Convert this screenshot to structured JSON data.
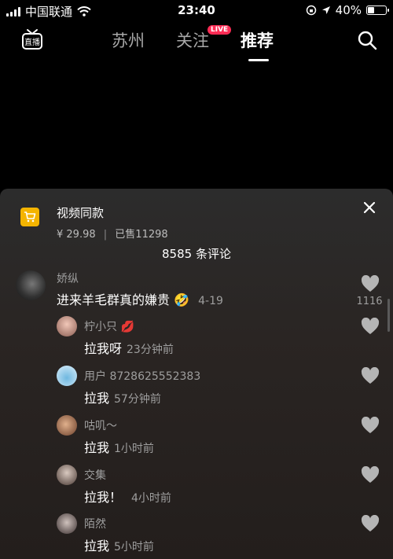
{
  "status_bar": {
    "carrier": "中国联通",
    "time": "23:40",
    "battery": "40%",
    "battery_level": 0.4,
    "icons": [
      "signal-icon",
      "wifi-icon",
      "rotation-lock-icon",
      "location-icon",
      "battery-icon"
    ]
  },
  "nav": {
    "tabs": [
      {
        "label": "苏州"
      },
      {
        "label": "关注"
      },
      {
        "label": "推荐"
      }
    ],
    "active_tab": "推荐",
    "live_badge": "LIVE",
    "live_icon_label": "直播",
    "accent_color": "#fe2c55"
  },
  "product": {
    "title": "视频同款",
    "price": "¥ 29.98",
    "separator": "|",
    "sold": "已售11298"
  },
  "comments_count": "8585 条评论",
  "comments": [
    {
      "name": "娇纵",
      "text": "进来羊毛群真的嫌贵",
      "emoji": "🤣",
      "time": "4-19",
      "likes": "1116"
    },
    {
      "name": "柠小只",
      "badge": "💋",
      "text": "拉我呀",
      "time": "23分钟前"
    },
    {
      "name": "用户 8728625552383",
      "text": "拉我",
      "time": "57分钟前"
    },
    {
      "name": "咕叽～",
      "text": "拉我",
      "time": "1小时前"
    },
    {
      "name": "交集",
      "text": "拉我！",
      "time": "4小时前"
    },
    {
      "name": "陌然",
      "text": "拉我",
      "time": "5小时前"
    }
  ]
}
